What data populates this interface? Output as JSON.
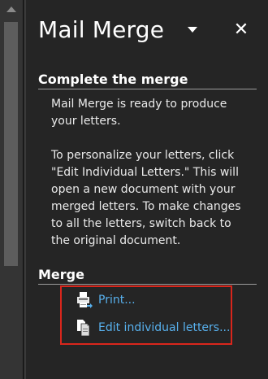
{
  "pane": {
    "title": "Mail Merge",
    "menu_icon": "chevron-down-icon",
    "close_icon": "close-icon",
    "close_glyph": "✕"
  },
  "complete_section": {
    "heading": "Complete the merge",
    "paragraph1": "Mail Merge is ready to produce your letters.",
    "paragraph2": "To personalize your letters, click \"Edit Individual Letters.\" This will open a new document with your merged letters. To make changes to all the letters, switch back to the original document."
  },
  "merge_section": {
    "heading": "Merge",
    "items": [
      {
        "label": "Print...",
        "icon": "printer-icon"
      },
      {
        "label": "Edit individual letters...",
        "icon": "documents-icon"
      }
    ]
  },
  "colors": {
    "pane_background": "#252525",
    "link": "#58b1ee",
    "highlight_border": "#d9261c"
  }
}
